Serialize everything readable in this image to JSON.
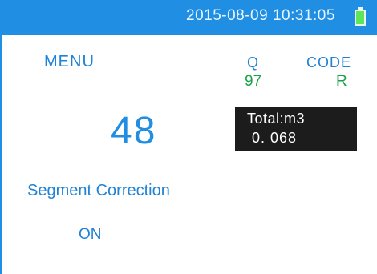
{
  "status_bar": {
    "datetime": "2015-08-09 10:31:05",
    "battery_icon": "battery-icon",
    "battery_level": 1.0,
    "colors": {
      "background": "#1f8ee3",
      "battery_fill": "#5ee65b"
    }
  },
  "menu": {
    "label": "MENU",
    "number": "48"
  },
  "readings": {
    "q_label": "Q",
    "q_value": "97",
    "code_label": "CODE",
    "code_value": "R"
  },
  "total": {
    "label": "Total:m3",
    "value": "0. 068"
  },
  "segment": {
    "label": "Segment Correction",
    "value": "ON"
  },
  "colors": {
    "label_blue": "#1f82d6",
    "value_green": "#18a24a",
    "number_blue": "#1f8ee3",
    "total_box": "#1c1c1c"
  }
}
